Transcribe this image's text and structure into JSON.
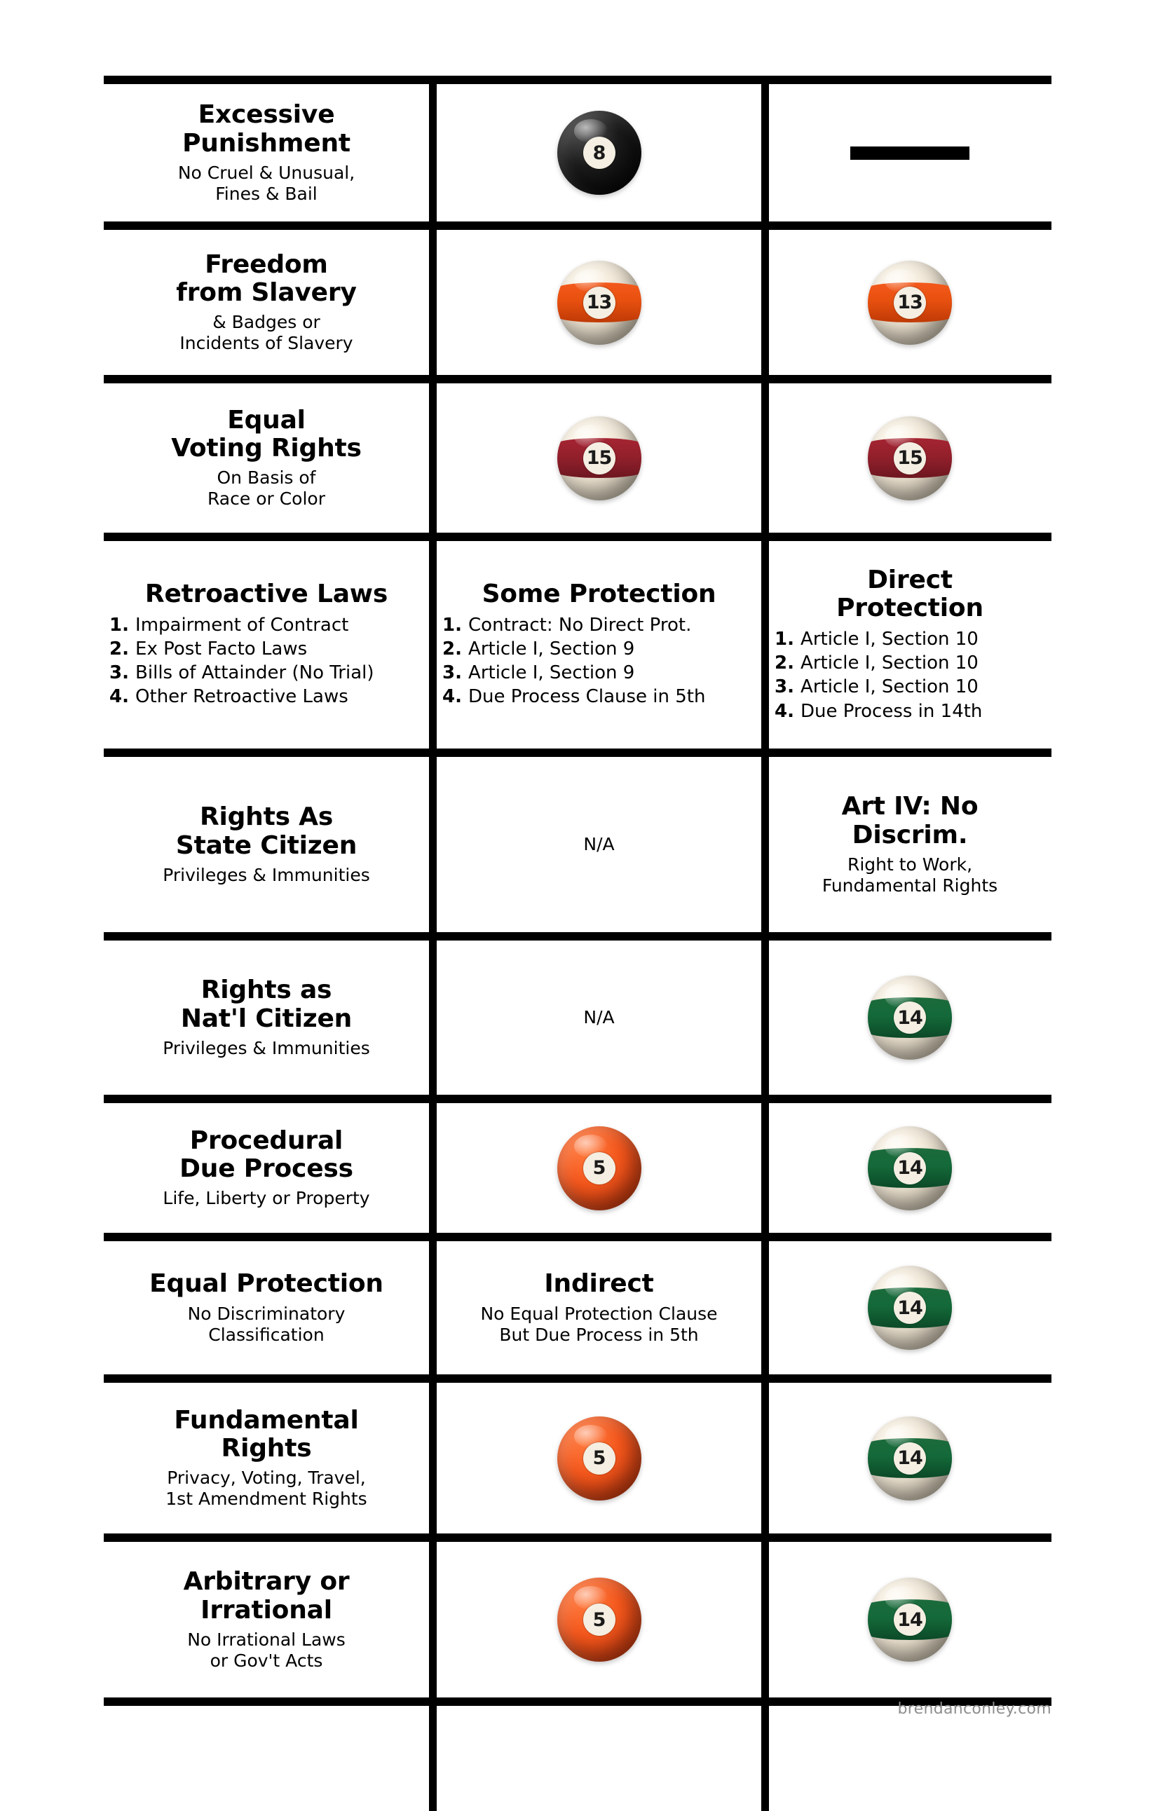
{
  "watermark": "brendanconley.com",
  "columns": {
    "label_header": "",
    "middle_header": "",
    "right_header": ""
  },
  "rows": [
    {
      "label": {
        "title": "Excessive\nPunishment",
        "sub": "No Cruel & Unusual,\nFines & Bail"
      },
      "middle": {
        "kind": "ball",
        "ball": "8",
        "style": "solid-black",
        "number": "8"
      },
      "right": {
        "kind": "dash"
      }
    },
    {
      "label": {
        "title": "Freedom\nfrom Slavery",
        "sub": "& Badges or\nIncidents of Slavery"
      },
      "middle": {
        "kind": "ball",
        "ball": "13",
        "style": "stripe-orange",
        "number": "13"
      },
      "right": {
        "kind": "ball",
        "ball": "13",
        "style": "stripe-orange",
        "number": "13"
      }
    },
    {
      "label": {
        "title": "Equal\nVoting Rights",
        "sub": "On Basis of\nRace or Color"
      },
      "middle": {
        "kind": "ball",
        "ball": "15",
        "style": "stripe-maroon",
        "number": "15"
      },
      "right": {
        "kind": "ball",
        "ball": "15",
        "style": "stripe-maroon",
        "number": "15"
      }
    },
    {
      "label": {
        "title": "Retroactive Laws",
        "list": [
          {
            "n": "1.",
            "text": "Impairment of Contract"
          },
          {
            "n": "2.",
            "text": "Ex Post Facto Laws"
          },
          {
            "n": "3.",
            "text": "Bills of Attainder (No Trial)"
          },
          {
            "n": "4.",
            "text": "Other Retroactive Laws"
          }
        ]
      },
      "middle": {
        "kind": "list",
        "title": "Some Protection",
        "list": [
          {
            "n": "1.",
            "text": "Contract: No Direct Prot."
          },
          {
            "n": "2.",
            "text": "Article I, Section 9"
          },
          {
            "n": "3.",
            "text": "Article I, Section 9"
          },
          {
            "n": "4.",
            "text": "Due Process Clause in 5th"
          }
        ]
      },
      "right": {
        "kind": "list",
        "title": "Direct\nProtection",
        "list": [
          {
            "n": "1.",
            "text": "Article I, Section 10"
          },
          {
            "n": "2.",
            "text": "Article I, Section 10"
          },
          {
            "n": "3.",
            "text": "Article I, Section 10"
          },
          {
            "n": "4.",
            "text": "Due Process in 14th"
          }
        ]
      }
    },
    {
      "label": {
        "title": "Rights As\nState Citizen",
        "sub": "Privileges & Immunities"
      },
      "middle": {
        "kind": "text",
        "text": "N/A"
      },
      "right": {
        "kind": "titlesub",
        "title": "Art IV: No\nDiscrim.",
        "sub": "Right to Work,\nFundamental Rights"
      }
    },
    {
      "label": {
        "title": "Rights as\nNat'l Citizen",
        "sub": "Privileges & Immunities"
      },
      "middle": {
        "kind": "text",
        "text": "N/A"
      },
      "right": {
        "kind": "ball",
        "ball": "14",
        "style": "stripe-green",
        "number": "14"
      }
    },
    {
      "label": {
        "title": "Procedural\nDue Process",
        "sub": "Life, Liberty or Property"
      },
      "middle": {
        "kind": "ball",
        "ball": "5",
        "style": "solid-orange",
        "number": "5"
      },
      "right": {
        "kind": "ball",
        "ball": "14",
        "style": "stripe-green",
        "number": "14"
      }
    },
    {
      "label": {
        "title": "Equal Protection",
        "sub": "No Discriminatory\nClassification"
      },
      "middle": {
        "kind": "titlesub",
        "title": "Indirect",
        "sub": "No Equal Protection Clause\nBut Due Process in 5th"
      },
      "right": {
        "kind": "ball",
        "ball": "14",
        "style": "stripe-green",
        "number": "14"
      }
    },
    {
      "label": {
        "title": "Fundamental\nRights",
        "sub": "Privacy, Voting, Travel,\n1st Amendment Rights"
      },
      "middle": {
        "kind": "ball",
        "ball": "5",
        "style": "solid-orange",
        "number": "5"
      },
      "right": {
        "kind": "ball",
        "ball": "14",
        "style": "stripe-green",
        "number": "14"
      }
    },
    {
      "label": {
        "title": "Arbitrary or\nIrrational",
        "sub": "No Irrational Laws\nor Gov't Acts"
      },
      "middle": {
        "kind": "ball",
        "ball": "5",
        "style": "solid-orange",
        "number": "5"
      },
      "right": {
        "kind": "ball",
        "ball": "14",
        "style": "stripe-green",
        "number": "14"
      }
    }
  ]
}
